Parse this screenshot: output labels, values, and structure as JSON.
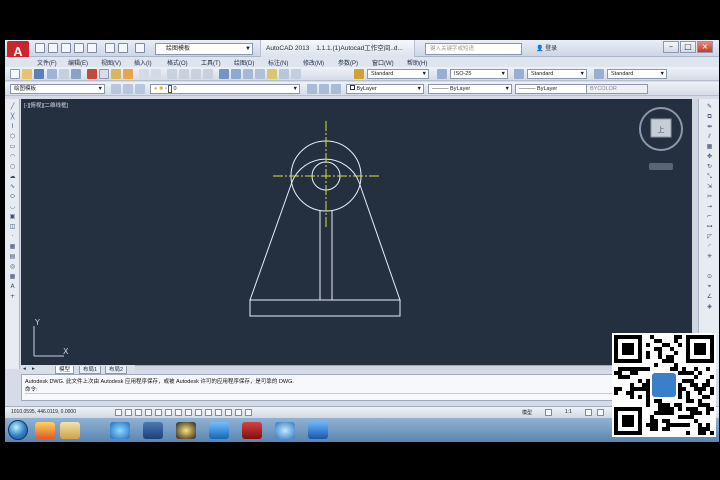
{
  "window": {
    "title": "AutoCAD 2013",
    "document_title": "1.1.1.(1)Autocad工作空间..d...",
    "search_placeholder": "键入关键字或短语",
    "signin_label": "登录",
    "workspace": "绘图模板",
    "minimize": "–",
    "maximize": "□",
    "close": "×"
  },
  "menu": [
    "文件(F)",
    "编辑(E)",
    "视图(V)",
    "插入(I)",
    "格式(O)",
    "工具(T)",
    "绘图(D)",
    "标注(N)",
    "修改(M)",
    "参数(P)",
    "窗口(W)",
    "帮助(H)"
  ],
  "styles": {
    "text_style": "Standard",
    "dim_style": "ISO-25",
    "table_style": "Standard",
    "multileader_style": "Standard"
  },
  "layers": {
    "workspace_combo": "绘图模板",
    "current_layer": "0",
    "color": "ByLayer",
    "linetype": "ByLayer",
    "lineweight": "ByLayer",
    "plot_style": "BYCOLOR"
  },
  "viewport_label": "[-][俯视][二维线框]",
  "viewcube_label": "上",
  "layout_tabs": [
    "模型",
    "布局1",
    "布局2"
  ],
  "command_line": {
    "history_1": "Autodesk DWG.   此文件上次由 Autodesk 应用程序保存，或被 Autodesk 许可的应用程序保存，是可靠的 DWG.",
    "history_2": "命令:",
    "prompt": ""
  },
  "status": {
    "coordinates": "1010.0595, 446.0119, 0.0000",
    "model_label": "模型",
    "scale_label": "1:1"
  },
  "colors": {
    "canvas_bg": "#243040",
    "drawing_lines": "#e8eef6",
    "centerlines": "#d8e030",
    "axis_lines": "#c9d2df",
    "ribbon": "#d6dbe7",
    "taskbar": "#5b85b0"
  }
}
